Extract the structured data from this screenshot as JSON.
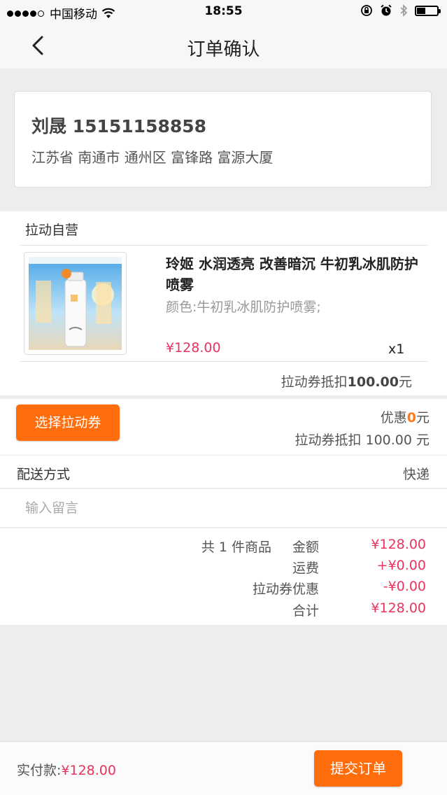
{
  "status_bar": {
    "carrier": "中国移动",
    "time": "18:55"
  },
  "nav": {
    "title": "订单确认"
  },
  "address": {
    "name_phone": "刘晟 15151158858",
    "address": "江苏省 南通市 通州区 富锋路 富源大厦"
  },
  "store": {
    "name": "拉动自营"
  },
  "product": {
    "title": "玲姬 水润透亮 改善暗沉 牛初乳冰肌防护喷雾",
    "attr": "颜色:牛初乳冰肌防护喷雾;",
    "price": "¥128.00",
    "qty": "x1",
    "voucher_prefix": "拉动券抵扣",
    "voucher_amount": "100.00",
    "voucher_unit": "元"
  },
  "voucher": {
    "button": "选择拉动券",
    "discount_prefix": "优惠",
    "discount_value": "0",
    "discount_unit": "元",
    "deduct_text": "拉动券抵扣 100.00 元"
  },
  "delivery": {
    "label": "配送方式",
    "value": "快递"
  },
  "message": {
    "placeholder": "输入留言"
  },
  "summary": {
    "count_text": "共 1 件商品",
    "rows": [
      {
        "label": "金额",
        "value": "¥128.00"
      },
      {
        "label": "运费",
        "value": "+¥0.00"
      },
      {
        "label": "拉动券优惠",
        "value": "-¥0.00"
      },
      {
        "label": "合计",
        "value": "¥128.00"
      }
    ]
  },
  "bottom": {
    "pay_label": "实付款:",
    "pay_value": "¥128.00",
    "submit": "提交订单"
  },
  "colors": {
    "accent": "#ff6d0d",
    "price": "#e8345f",
    "background": "#ededed"
  },
  "icons": [
    "signal-dots-icon",
    "wifi-icon",
    "rotation-lock-icon",
    "alarm-icon",
    "bluetooth-icon",
    "battery-icon",
    "back-arrow-icon"
  ]
}
